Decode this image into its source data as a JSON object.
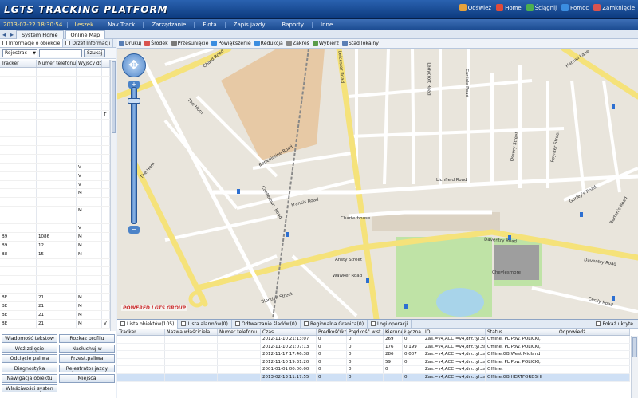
{
  "header": {
    "logo": "LGTS TRACKING PLATFORM",
    "links": [
      {
        "label": "Odśwież",
        "icon": "refresh-icon",
        "color": "#e6a23c"
      },
      {
        "label": "Home",
        "icon": "home-icon",
        "color": "#e04b3a"
      },
      {
        "label": "Ściągnij",
        "icon": "download-icon",
        "color": "#4caf50"
      },
      {
        "label": "Pomoc",
        "icon": "help-icon",
        "color": "#3b8de0"
      },
      {
        "label": "Zamknięcie",
        "icon": "close-icon",
        "color": "#d9534f"
      }
    ]
  },
  "menubar": {
    "datetime": "2013-07-22 18:30:54",
    "user": "Leszek",
    "items": [
      "Nav Track",
      "Zarządzanie",
      "Flota",
      "Zapis jazdy",
      "Raporty",
      "Inne"
    ]
  },
  "tabs": {
    "items": [
      "System Home",
      "Online Map"
    ]
  },
  "left": {
    "tabs": [
      "Informacje o obiekcie",
      "Drzef Informacji"
    ],
    "filter_select": "Rejestrac",
    "search_button": "Szukaj",
    "columns": [
      "Tracker",
      "Numer telefonu",
      "Wyjścy do"
    ],
    "rows": [
      [
        "",
        "",
        "",
        ""
      ],
      [
        "",
        "",
        "",
        ""
      ],
      [
        "",
        "",
        "",
        ""
      ],
      [
        "",
        "",
        "",
        ""
      ],
      [
        "",
        "",
        "",
        ""
      ],
      [
        "",
        "",
        "",
        "T"
      ],
      [
        "",
        "",
        "",
        ""
      ],
      [
        "",
        "",
        "",
        ""
      ],
      [
        "",
        "",
        "",
        ""
      ],
      [
        "",
        "",
        "",
        ""
      ],
      [
        "",
        "",
        "",
        ""
      ],
      [
        "",
        "",
        "V",
        ""
      ],
      [
        "",
        "",
        "V",
        ""
      ],
      [
        "",
        "",
        "V",
        ""
      ],
      [
        "",
        "",
        "M",
        ""
      ],
      [
        "",
        "",
        "",
        ""
      ],
      [
        "",
        "",
        "M",
        ""
      ],
      [
        "",
        "",
        "",
        ""
      ],
      [
        "",
        "",
        "V",
        ""
      ],
      [
        "B9",
        "1086",
        "M",
        ""
      ],
      [
        "B9",
        "12",
        "M",
        ""
      ],
      [
        "B8",
        "15",
        "M",
        ""
      ],
      [
        "",
        "",
        "",
        ""
      ],
      [
        "",
        "",
        "",
        ""
      ],
      [
        "",
        "",
        "",
        ""
      ],
      [
        "",
        "",
        "",
        ""
      ],
      [
        "BE",
        "21",
        "M",
        ""
      ],
      [
        "BE",
        "21",
        "M",
        ""
      ],
      [
        "BE",
        "21",
        "M",
        ""
      ],
      [
        "BE",
        "21",
        "M",
        "V"
      ]
    ],
    "buttons": [
      "Wiadomość tekstow",
      "Rozkaz profilu",
      "Weź zdjęcie",
      "Nasłuchuj w",
      "Odcięcie paliwa",
      "Przest.paliwa",
      "Diagnostyka",
      "Rejestrator jazdy",
      "Nawigacja obiektu",
      "Miejsca",
      "Właściwości systen",
      ""
    ]
  },
  "maptoolbar": {
    "items": [
      {
        "label": "Drukuj",
        "icon": "print-icon",
        "color": "#5a7fb5"
      },
      {
        "label": "Środek",
        "icon": "center-icon",
        "color": "#d9534f"
      },
      {
        "label": "Przesunięcie",
        "icon": "pan-icon",
        "color": "#7a7a7a"
      },
      {
        "label": "Powiększenie",
        "icon": "zoom-in-icon",
        "color": "#3b8de0"
      },
      {
        "label": "Redukcja",
        "icon": "zoom-out-icon",
        "color": "#3b8de0"
      },
      {
        "label": "Zakres",
        "icon": "range-icon",
        "color": "#888"
      },
      {
        "label": "Wybierz",
        "icon": "select-icon",
        "color": "#5a9c4a"
      },
      {
        "label": "Stad lokalny",
        "icon": "local-icon",
        "color": "#5a7fb5"
      }
    ]
  },
  "map": {
    "labels": [
      "Daventry Road",
      "Daventry Road",
      "Lichfield Road",
      "Francis Road",
      "Benedictine Road",
      "Chard Road",
      "The Horn",
      "The Horn",
      "Leicester Road",
      "Canterbury Road",
      "Harnall Lane",
      "Gurley's Road",
      "Barton's Road",
      "Cecily Road",
      "Ladycroft Road",
      "Poynter Street",
      "Ossory Street",
      "Carlisle Road",
      "Charterhouse",
      "Blondvil Street",
      "Ansty Street",
      "Cheylesmore",
      "Wawker Road",
      "Bus Stop"
    ],
    "brand": "POWERED LGTS GROUP",
    "colors": {
      "bg": "#e9e5dc",
      "road": "#ffffff",
      "major_road": "#f7e88a",
      "park": "#bfe3a6",
      "building": "#dcd3c4"
    }
  },
  "bottom": {
    "tabs": [
      "Lista obiektów(105)",
      "Lista alarmów(0)",
      "Odtwarzanie śladów(0)",
      "Regionalna Granica(0)",
      "Logi operacji"
    ],
    "right": "Pokaż ukryte",
    "columns": [
      "Tracker",
      "Nazwa właściciela",
      "Numer telefonu",
      "Czas",
      "Prędkość(km",
      "Prędkość w.st",
      "Kierunek",
      "Łączna odleg",
      "IO",
      "Status",
      "Odpowiedź"
    ],
    "rows": [
      [
        "",
        "",
        "",
        "2012-11-10 21:13:07",
        "0",
        "0",
        "269",
        "0",
        "Zas.=v4,ACC =v4,drz.tyl.zam",
        "Offline, PL Pow. POLICKI,",
        ""
      ],
      [
        "",
        "",
        "",
        "2012-11-10 21:07:13",
        "0",
        "0",
        "176",
        "0.199",
        "Zas.=v4,ACC =v4,drz.tyl.zam",
        "Offline, PL Pow. POLICKI,",
        ""
      ],
      [
        "",
        "",
        "",
        "2012-11-17 17:46:38",
        "0",
        "0",
        "286",
        "0.007",
        "Zas.=v4,ACC =v4,drz.tyl.zam",
        "Offline,GB,West Midland",
        ""
      ],
      [
        "",
        "",
        "",
        "2012-11-10 19:31:20",
        "0",
        "0",
        "59",
        "0",
        "Zas.=v4,ACC =v4,drz.tyl.zam",
        "Offline, PL Pow. POLICKI,",
        ""
      ],
      [
        "",
        "",
        "",
        "2001-01-01 00:00:00",
        "0",
        "0",
        "0",
        "",
        "Zas.=v4,ACC =v4,drz.tyl.zam",
        "Offline.",
        ""
      ],
      [
        "",
        "",
        "",
        "2013-02-13 11:17:55",
        "0",
        "0",
        "",
        "0",
        "Zas.=v4,ACC =v4,drz.tyl.zam",
        "Offline,GB HERTFORDSHI",
        ""
      ]
    ]
  }
}
